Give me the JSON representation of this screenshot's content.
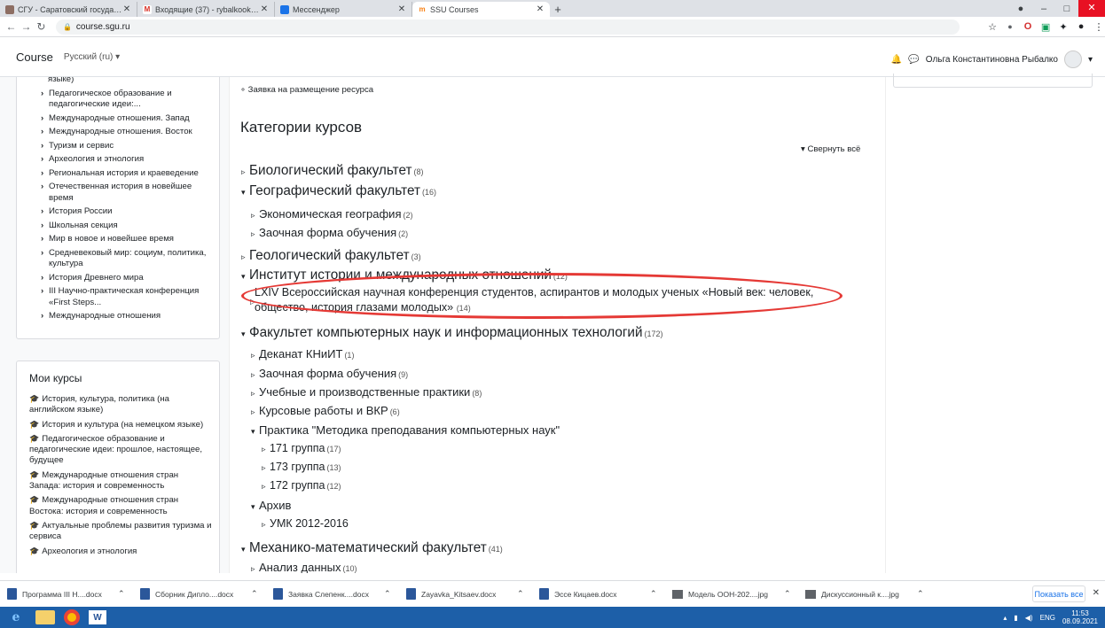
{
  "browser": {
    "tabs": [
      {
        "title": "СГУ - Саратовский государственн",
        "fav": "sgu-icon",
        "active": false
      },
      {
        "title": "Входящие (37) - rybalkook@gm",
        "fav": "gmail-icon",
        "active": false
      },
      {
        "title": "Мессенджер",
        "fav": "messenger-icon",
        "active": false
      },
      {
        "title": "SSU Courses",
        "fav": "moodle-icon",
        "active": true
      }
    ],
    "url": "course.sgu.ru"
  },
  "navbar": {
    "brand": "Course",
    "language": "Русский (ru) ▾",
    "user_name": "Ольга Константиновна Рыбалко"
  },
  "sidebar_categories": [
    {
      "text": "языке)",
      "chev": false
    },
    {
      "text": "Педагогическое образование и педагогические идеи:...",
      "chev": true
    },
    {
      "text": "Международные отношения. Запад",
      "chev": true
    },
    {
      "text": "Международные отношения. Восток",
      "chev": true
    },
    {
      "text": "Туризм и сервис",
      "chev": true
    },
    {
      "text": "Археология и этнология",
      "chev": true
    },
    {
      "text": "Региональная история и краеведение",
      "chev": true
    },
    {
      "text": "Отечественная история в новейшее время",
      "chev": true
    },
    {
      "text": "История России",
      "chev": true
    },
    {
      "text": "Школьная секция",
      "chev": true
    },
    {
      "text": "Мир в новое и новейшее время",
      "chev": true
    },
    {
      "text": "Средневековый мир: социум, политика, культура",
      "chev": true
    },
    {
      "text": "История Древнего мира",
      "chev": true
    },
    {
      "text": "III Научно-практическая конференция «First Steps...",
      "chev": true
    },
    {
      "text": "Международные отношения",
      "chev": true
    }
  ],
  "my_courses": {
    "title": "Мои курсы",
    "items": [
      "История, культура, политика (на английском языке)",
      "История и культура (на немецком языке)",
      "Педагогическое образование и педагогические идеи: прошлое, настоящее, будущее",
      "Международные отношения стран Запада: история и современность",
      "Международные отношения стран Востока: история и современность",
      "Актуальные проблемы развития туризма и сервиса",
      "Археология и этнология"
    ]
  },
  "main": {
    "resource_request": "Заявка на размещение ресурса",
    "title": "Категории курсов",
    "collapse_all": "Свернуть всё",
    "conference": {
      "name": "LXIV Всероссийская научная конференция студентов, аспирантов и молодых ученых «Новый век: человек, общество, история глазами молодых»",
      "count": "(14)"
    },
    "categories": [
      {
        "name": "Биологический факультет",
        "count": "(8)",
        "level": 1,
        "open": false
      },
      {
        "name": "Географический факультет",
        "count": "(16)",
        "level": 1,
        "open": true
      },
      {
        "name": "Экономическая география",
        "count": "(2)",
        "level": 2,
        "open": false
      },
      {
        "name": "Заочная форма обучения",
        "count": "(2)",
        "level": 2,
        "open": false
      },
      {
        "name": "Геологический факультет",
        "count": "(3)",
        "level": 1,
        "open": false
      },
      {
        "name": "Институт истории и международных отношений",
        "count": "(12)",
        "level": 1,
        "open": true
      },
      {
        "name": "Факультет компьютерных наук и информационных технологий",
        "count": "(172)",
        "level": 1,
        "open": true
      },
      {
        "name": "Деканат КНиИТ",
        "count": "(1)",
        "level": 2,
        "open": false
      },
      {
        "name": "Заочная форма обучения",
        "count": "(9)",
        "level": 2,
        "open": false
      },
      {
        "name": "Учебные и производственные практики",
        "count": "(8)",
        "level": 2,
        "open": false
      },
      {
        "name": "Курсовые работы и ВКР",
        "count": "(6)",
        "level": 2,
        "open": false
      },
      {
        "name": "Практика \"Методика преподавания компьютерных наук\"",
        "count": "",
        "level": 2,
        "open": true
      },
      {
        "name": "171 группа",
        "count": "(17)",
        "level": 3,
        "open": false
      },
      {
        "name": "173 группа",
        "count": "(13)",
        "level": 3,
        "open": false
      },
      {
        "name": "172 группа",
        "count": "(12)",
        "level": 3,
        "open": false
      },
      {
        "name": "Архив",
        "count": "",
        "level": 2,
        "open": true
      },
      {
        "name": "УМК 2012-2016",
        "count": "",
        "level": 3,
        "open": false
      },
      {
        "name": "Механико-математический факультет",
        "count": "(41)",
        "level": 1,
        "open": true
      },
      {
        "name": "Анализ данных",
        "count": "(10)",
        "level": 2,
        "open": false
      }
    ]
  },
  "downloads": {
    "items": [
      {
        "name": "Программа III Н....docx",
        "type": "docx"
      },
      {
        "name": "Сборник Дипло....docx",
        "type": "docx"
      },
      {
        "name": "Заявка Слепенк....docx",
        "type": "docx"
      },
      {
        "name": "Zayavka_Kitsaev.docx",
        "type": "docx"
      },
      {
        "name": "Эссе Кицаев.docx",
        "type": "docx"
      },
      {
        "name": "Модель ООН-202....jpg",
        "type": "jpg"
      },
      {
        "name": "Дискуссионный к....jpg",
        "type": "jpg"
      }
    ],
    "show_all": "Показать все"
  },
  "taskbar": {
    "lang": "ENG",
    "time": "11:53",
    "date": "08.09.2021"
  },
  "colors": {
    "highlight_ellipse": "#e53935",
    "taskbar": "#1d5fa8",
    "close_button": "#e81123"
  }
}
